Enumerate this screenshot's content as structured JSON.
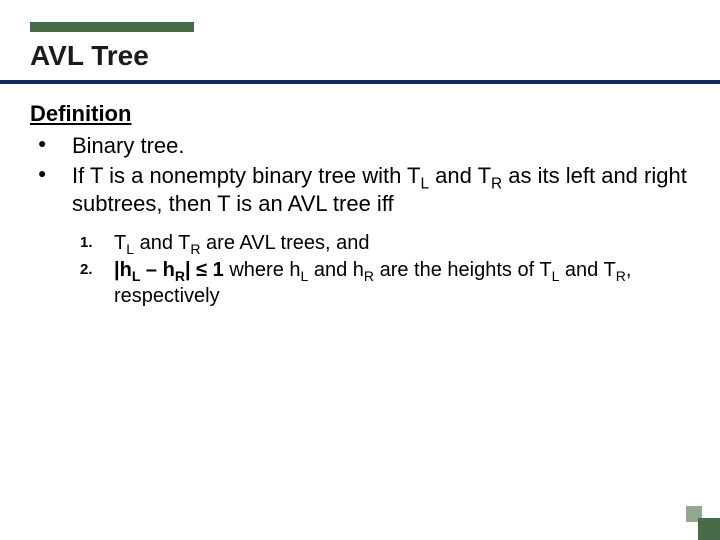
{
  "colors": {
    "accent": "#4A6B4A",
    "rule": "#0B2E5A"
  },
  "title": "AVL Tree",
  "heading": "Definition",
  "bullets": {
    "b1": "Binary tree.",
    "b2_pre": "If T is a nonempty binary tree with T",
    "b2_mid1": " and T",
    "b2_post": " as its left and right subtrees, then T is an AVL tree iff",
    "sub_L": "L",
    "sub_R": "R"
  },
  "numbered": {
    "n1_marker": "1.",
    "n1_pre": "T",
    "n1_mid": " and T",
    "n1_post": " are AVL trees, and",
    "n2_marker": "2.",
    "n2_b_open": "|h",
    "n2_b_mid": " – h",
    "n2_b_close": "| ",
    "n2_le": "≤",
    "n2_one": " 1",
    "n2_where_pre": " where h",
    "n2_where_mid": " and h",
    "n2_where_post": " are the heights of T",
    "n2_tail_mid": " and T",
    "n2_tail_post": ", respectively"
  }
}
